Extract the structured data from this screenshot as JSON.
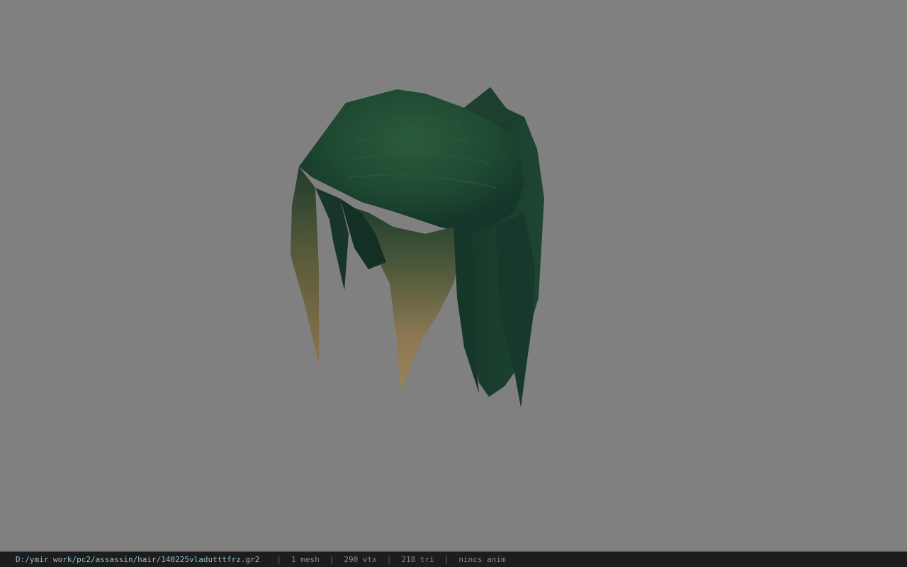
{
  "viewport": {
    "background_color": "#808080",
    "model_name": "hair-mesh"
  },
  "status_bar": {
    "file_path": "D:/ymir work/pc2/assassin/hair/140225vladutttfrz.gr2",
    "separator": "|",
    "mesh_count": "1 mesh",
    "vertex_count": "290 vtx",
    "triangle_count": "218 tri",
    "animation_status": "nincs anim",
    "path_color": "#8fc0d6",
    "text_color": "#8a8a8a"
  }
}
